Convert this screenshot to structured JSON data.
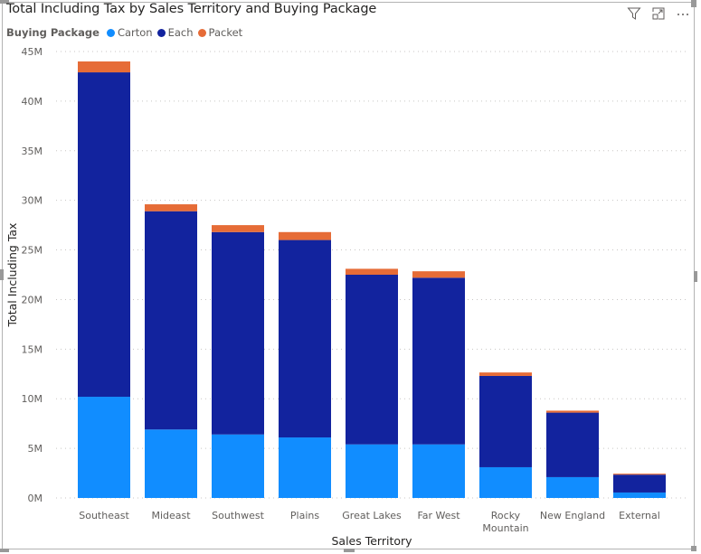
{
  "visual": {
    "title": "Total Including Tax by Sales Territory and Buying Package",
    "header_icons": [
      {
        "name": "filter-icon",
        "glyph": "funnel"
      },
      {
        "name": "focus-mode-icon",
        "glyph": "expand"
      },
      {
        "name": "more-options-icon",
        "glyph": "ellipsis",
        "label": "···"
      }
    ]
  },
  "legend": {
    "title": "Buying Package",
    "items": [
      {
        "label": "Carton",
        "color": "#118DFF"
      },
      {
        "label": "Each",
        "color": "#12239E"
      },
      {
        "label": "Packet",
        "color": "#E66C37"
      }
    ]
  },
  "chart_data": {
    "type": "bar",
    "stacked": true,
    "orientation": "vertical",
    "title": "Total Including Tax by Sales Territory and Buying Package",
    "xlabel": "Sales Territory",
    "ylabel": "Total Including Tax",
    "ylim": [
      0,
      45
    ],
    "y_unit_suffix": "M",
    "yticks": [
      "0M",
      "5M",
      "10M",
      "15M",
      "20M",
      "25M",
      "30M",
      "35M",
      "40M",
      "45M"
    ],
    "ytick_values": [
      0,
      5,
      10,
      15,
      20,
      25,
      30,
      35,
      40,
      45
    ],
    "grid": true,
    "legend_position": "top-left",
    "categories": [
      "Southeast",
      "Mideast",
      "Southwest",
      "Plains",
      "Great Lakes",
      "Far West",
      "Rocky Mountain",
      "New England",
      "External"
    ],
    "category_lines": [
      [
        "Southeast"
      ],
      [
        "Mideast"
      ],
      [
        "Southwest"
      ],
      [
        "Plains"
      ],
      [
        "Great Lakes"
      ],
      [
        "Far West"
      ],
      [
        "Rocky",
        "Mountain"
      ],
      [
        "New England"
      ],
      [
        "External"
      ]
    ],
    "series": [
      {
        "name": "Carton",
        "color": "#118DFF",
        "values": [
          10.2,
          6.9,
          6.4,
          6.1,
          5.4,
          5.4,
          3.1,
          2.1,
          0.55
        ]
      },
      {
        "name": "Each",
        "color": "#12239E",
        "values": [
          32.7,
          22.0,
          20.4,
          19.9,
          17.1,
          16.8,
          9.2,
          6.5,
          1.8
        ]
      },
      {
        "name": "Packet",
        "color": "#E66C37",
        "values": [
          1.1,
          0.7,
          0.7,
          0.8,
          0.6,
          0.65,
          0.35,
          0.2,
          0.1
        ]
      }
    ]
  }
}
